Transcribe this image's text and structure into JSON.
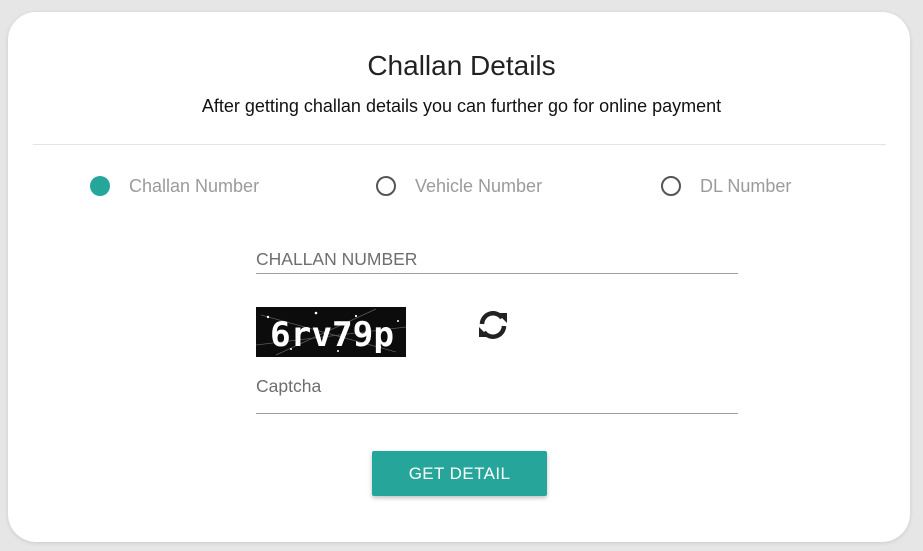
{
  "header": {
    "title": "Challan Details",
    "subtitle": "After getting challan details you can further go for online payment"
  },
  "search_by": {
    "options": [
      {
        "label": "Challan Number",
        "checked": true
      },
      {
        "label": "Vehicle Number",
        "checked": false
      },
      {
        "label": "DL Number",
        "checked": false
      }
    ]
  },
  "form": {
    "challan_placeholder": "CHALLAN NUMBER",
    "captcha_text": "6rv79p",
    "captcha_placeholder": "Captcha",
    "submit_label": "GET DETAIL"
  },
  "colors": {
    "accent": "#26a69a",
    "background": "#e6e6e6",
    "card": "#ffffff"
  },
  "icons": {
    "refresh": "refresh-icon"
  }
}
